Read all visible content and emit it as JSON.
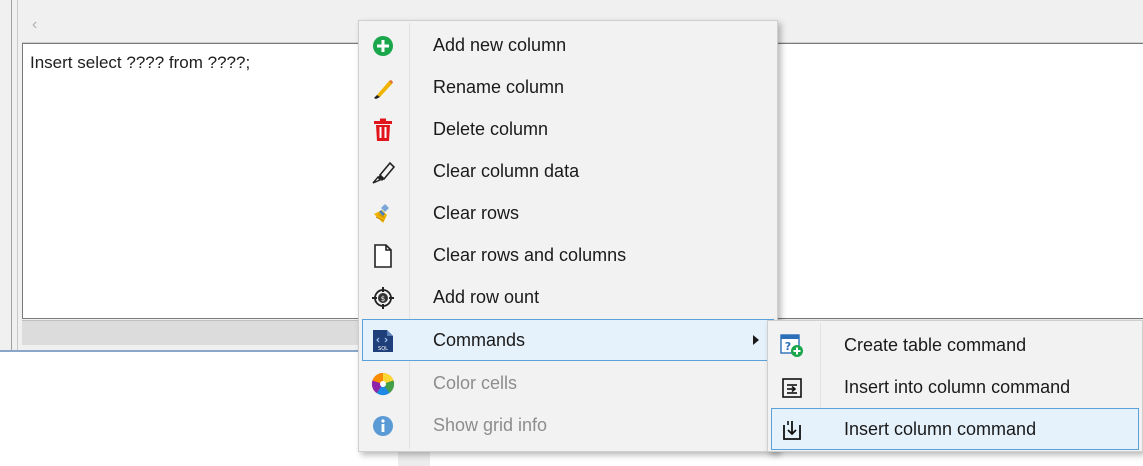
{
  "editor": {
    "scroll_left_glyph": "‹",
    "text": "Insert select ???? from ????;"
  },
  "context_menu": {
    "items": [
      {
        "label": "Add new column",
        "icon": "add-circle-icon",
        "enabled": true
      },
      {
        "label": "Rename column",
        "icon": "pencil-brush-icon",
        "enabled": true
      },
      {
        "label": "Delete column",
        "icon": "trash-icon",
        "enabled": true
      },
      {
        "label": "Clear column data",
        "icon": "highlighter-icon",
        "enabled": true
      },
      {
        "label": "Clear rows",
        "icon": "broom-icon",
        "enabled": true
      },
      {
        "label": "Clear rows and columns",
        "icon": "blank-page-icon",
        "enabled": true
      },
      {
        "label": "Add row ount",
        "icon": "counter-icon",
        "enabled": true
      },
      {
        "label": "Commands",
        "icon": "sql-file-icon",
        "enabled": true,
        "highlighted": true,
        "has_submenu": true
      },
      {
        "label": "Color cells",
        "icon": "color-wheel-icon",
        "enabled": false
      },
      {
        "label": "Show grid info",
        "icon": "info-icon",
        "enabled": false
      }
    ]
  },
  "commands_submenu": {
    "items": [
      {
        "label": "Create table command",
        "icon": "create-table-icon"
      },
      {
        "label": "Insert into column command",
        "icon": "insert-into-icon"
      },
      {
        "label": "Insert column command",
        "icon": "insert-column-icon",
        "highlighted": true
      }
    ]
  },
  "colors": {
    "highlight_bg": "#e5f1fb",
    "highlight_border": "#5ba2dd",
    "menu_bg": "#f2f2f2",
    "disabled_text": "#8d8d8d"
  }
}
